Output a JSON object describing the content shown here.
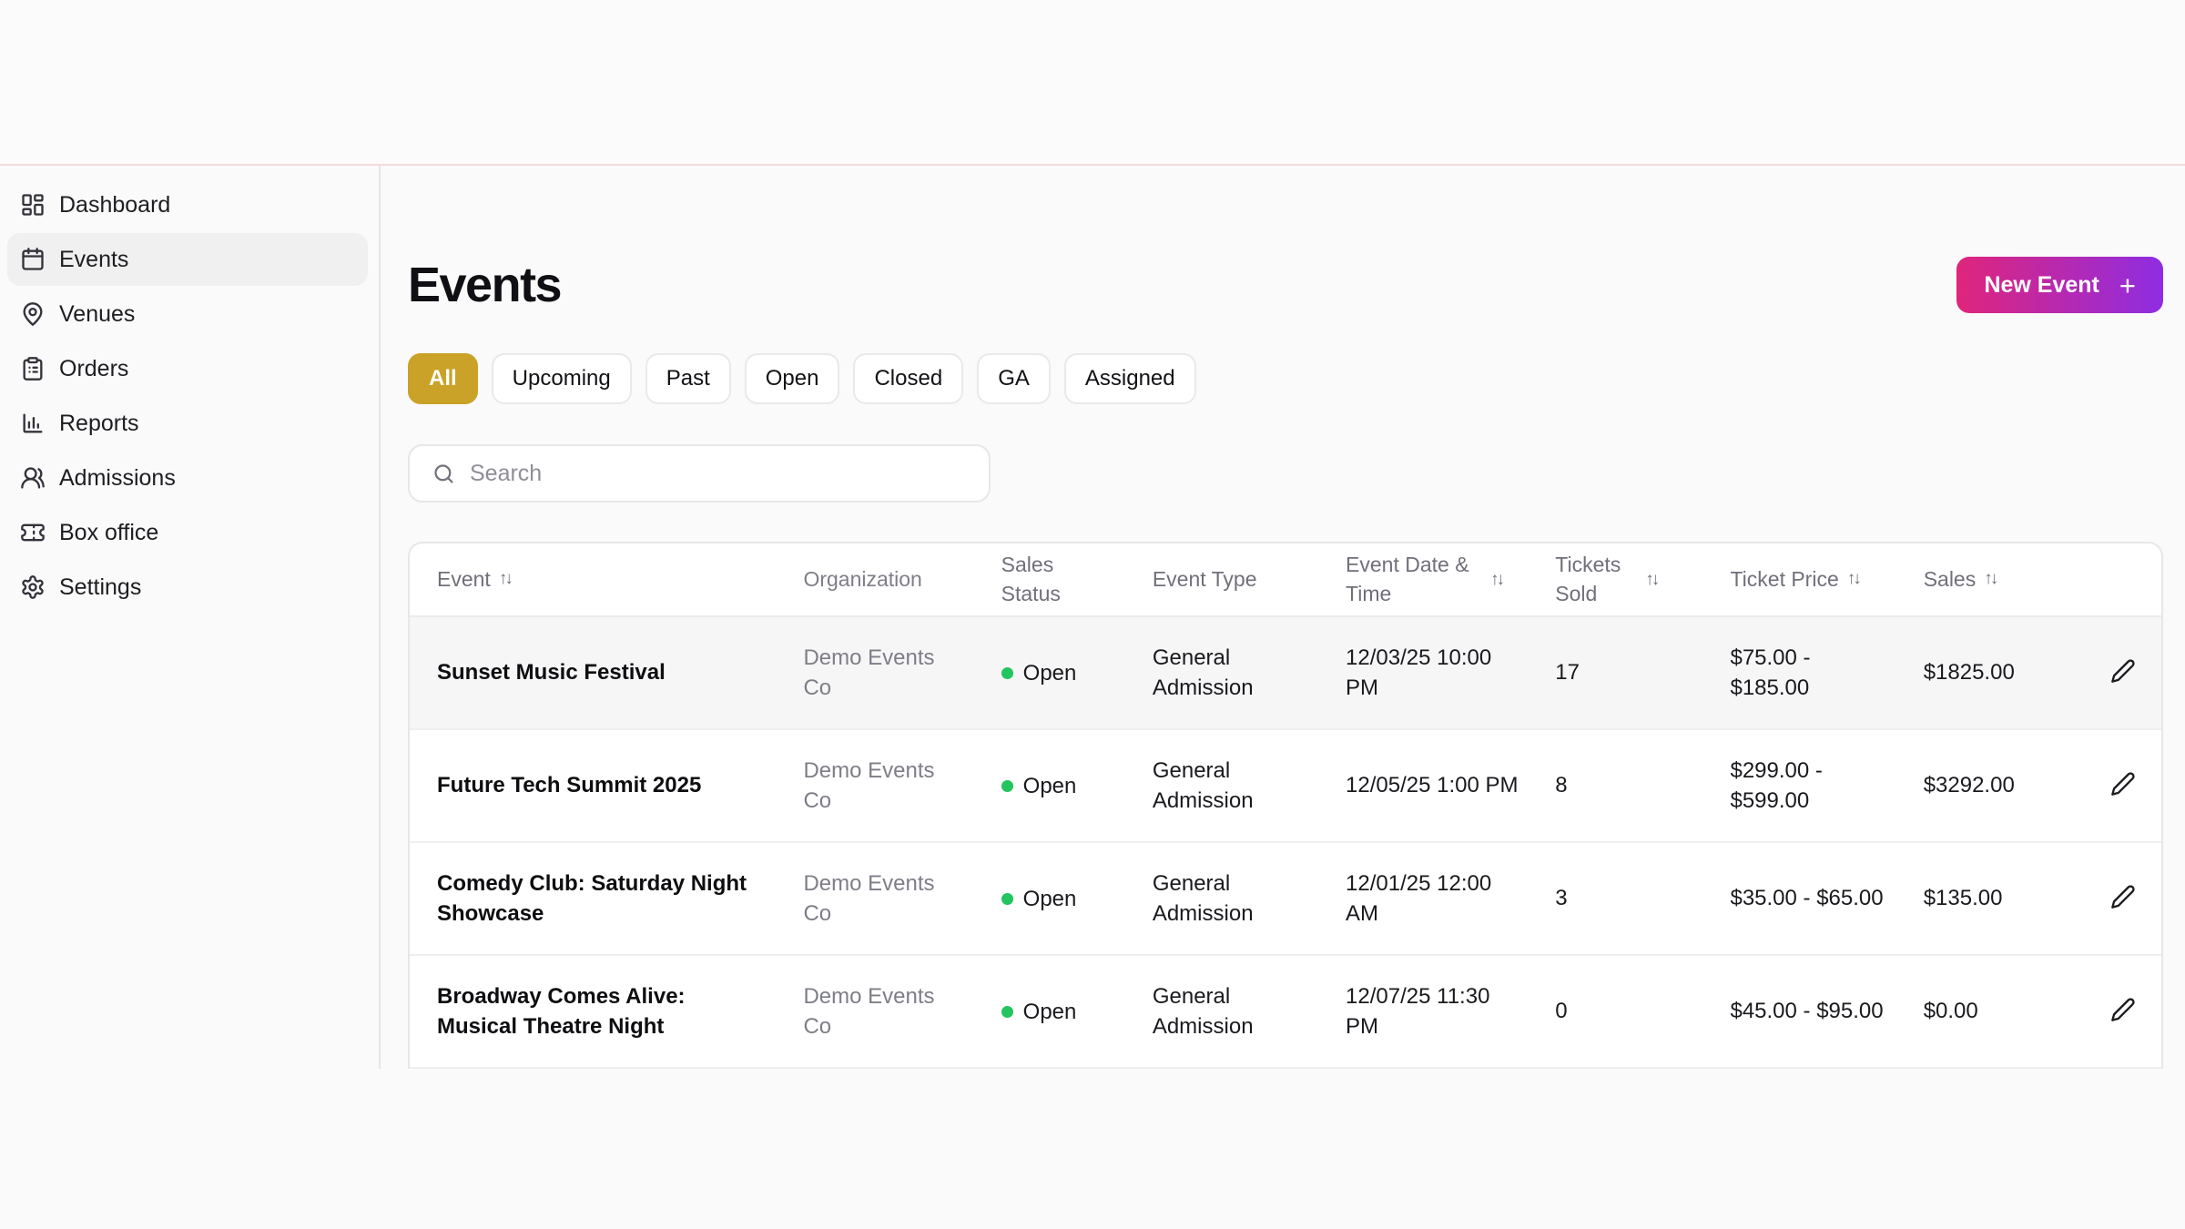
{
  "colors": {
    "accent_gold": "#C9A227",
    "button_gradient_start": "#E0257B",
    "button_gradient_end": "#8E2DE2",
    "status_open_green": "#22C55E",
    "top_divider_pink": "#F5DADB"
  },
  "sidebar": {
    "items": [
      {
        "id": "dashboard",
        "label": "Dashboard",
        "icon": "dashboard-icon",
        "active": false
      },
      {
        "id": "events",
        "label": "Events",
        "icon": "calendar-icon",
        "active": true
      },
      {
        "id": "venues",
        "label": "Venues",
        "icon": "map-pin-icon",
        "active": false
      },
      {
        "id": "orders",
        "label": "Orders",
        "icon": "clipboard-icon",
        "active": false
      },
      {
        "id": "reports",
        "label": "Reports",
        "icon": "bar-chart-icon",
        "active": false
      },
      {
        "id": "admissions",
        "label": "Admissions",
        "icon": "users-icon",
        "active": false
      },
      {
        "id": "box-office",
        "label": "Box office",
        "icon": "ticket-icon",
        "active": false
      },
      {
        "id": "settings",
        "label": "Settings",
        "icon": "gear-icon",
        "active": false
      }
    ]
  },
  "header": {
    "title": "Events",
    "new_event": {
      "label": "New Event",
      "plus": "+"
    }
  },
  "filters": [
    {
      "id": "all",
      "label": "All",
      "active": true
    },
    {
      "id": "upcoming",
      "label": "Upcoming",
      "active": false
    },
    {
      "id": "past",
      "label": "Past",
      "active": false
    },
    {
      "id": "open",
      "label": "Open",
      "active": false
    },
    {
      "id": "closed",
      "label": "Closed",
      "active": false
    },
    {
      "id": "ga",
      "label": "GA",
      "active": false
    },
    {
      "id": "assigned",
      "label": "Assigned",
      "active": false
    }
  ],
  "search": {
    "placeholder": "Search",
    "icon": "search-icon"
  },
  "table": {
    "sort_icon": "↑↓",
    "columns": [
      {
        "key": "event",
        "label": "Event",
        "sortable": true
      },
      {
        "key": "organization",
        "label": "Organization",
        "sortable": false
      },
      {
        "key": "sales_status",
        "label": "Sales Status",
        "sortable": false
      },
      {
        "key": "event_type",
        "label": "Event Type",
        "sortable": false
      },
      {
        "key": "event_datetime",
        "label": "Event Date & Time",
        "sortable": true
      },
      {
        "key": "tickets_sold",
        "label": "Tickets Sold",
        "sortable": true
      },
      {
        "key": "ticket_price",
        "label": "Ticket Price",
        "sortable": true
      },
      {
        "key": "sales",
        "label": "Sales",
        "sortable": true
      }
    ],
    "rows": [
      {
        "event": "Sunset Music Festival",
        "organization": "Demo Events Co",
        "sales_status": "Open",
        "event_type": "General Admission",
        "event_datetime": "12/03/25 10:00 PM",
        "tickets_sold": "17",
        "ticket_price": "$75.00 - $185.00",
        "sales": "$1825.00",
        "highlighted": true
      },
      {
        "event": "Future Tech Summit 2025",
        "organization": "Demo Events Co",
        "sales_status": "Open",
        "event_type": "General Admission",
        "event_datetime": "12/05/25 1:00 PM",
        "tickets_sold": "8",
        "ticket_price": "$299.00 - $599.00",
        "sales": "$3292.00",
        "highlighted": false
      },
      {
        "event": "Comedy Club: Saturday Night Showcase",
        "organization": "Demo Events Co",
        "sales_status": "Open",
        "event_type": "General Admission",
        "event_datetime": "12/01/25 12:00 AM",
        "tickets_sold": "3",
        "ticket_price": "$35.00 - $65.00",
        "sales": "$135.00",
        "highlighted": false
      },
      {
        "event": "Broadway Comes Alive: Musical Theatre Night",
        "organization": "Demo Events Co",
        "sales_status": "Open",
        "event_type": "General Admission",
        "event_datetime": "12/07/25 11:30 PM",
        "tickets_sold": "0",
        "ticket_price": "$45.00 - $95.00",
        "sales": "$0.00",
        "highlighted": false
      }
    ]
  }
}
